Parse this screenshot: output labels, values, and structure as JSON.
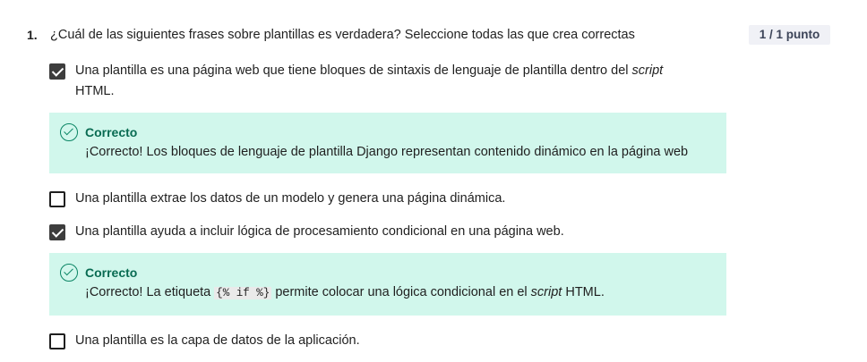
{
  "question": {
    "number": "1.",
    "text": "¿Cuál de las siguientes frases sobre plantillas es verdadera? Seleccione todas las que crea correctas",
    "score": "1 / 1 punto"
  },
  "options": [
    {
      "checked": true,
      "text_main": "Una plantilla es una página web que tiene bloques de sintaxis de lenguaje de plantilla dentro del ",
      "text_em": "script",
      "text_line2": "HTML."
    },
    {
      "checked": false,
      "text": "Una plantilla extrae los datos de un modelo y genera una página dinámica."
    },
    {
      "checked": true,
      "text": "Una plantilla ayuda a incluir lógica de procesamiento condicional en una página web."
    },
    {
      "checked": false,
      "text": "Una plantilla es la capa de datos de la aplicación."
    }
  ],
  "feedback": [
    {
      "title": "Correcto",
      "text": "¡Correcto! Los bloques de lenguaje de plantilla Django representan contenido dinámico en la página web"
    },
    {
      "title": "Correcto",
      "text_before": "¡Correcto! La etiqueta ",
      "code": "{% if %}",
      "text_middle": " permite colocar una lógica condicional en el ",
      "text_em": "script",
      "text_after": " HTML."
    }
  ],
  "colors": {
    "feedback_bg": "#d1f7ec",
    "feedback_accent": "#0a8564",
    "checkbox_checked": "#3d3d3d",
    "score_bg": "#f0f1f6"
  }
}
